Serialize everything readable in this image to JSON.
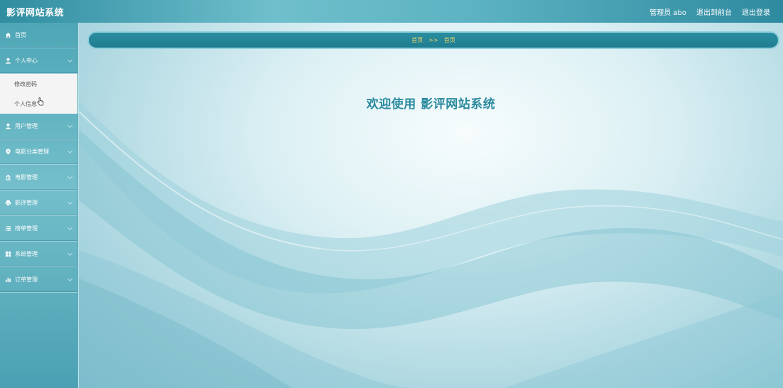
{
  "header": {
    "brand": "影评网站系统",
    "user_label": "管理员 abo",
    "frontend_link": "退出到前台",
    "logout_link": "退出登录"
  },
  "sidebar": {
    "items": [
      {
        "label": "首页",
        "icon": "home-icon"
      },
      {
        "label": "个人中心",
        "icon": "user-icon"
      },
      {
        "label": "用户管理",
        "icon": "user-icon"
      },
      {
        "label": "电影分类管理",
        "icon": "pin-icon"
      },
      {
        "label": "电影管理",
        "icon": "bank-icon"
      },
      {
        "label": "影评管理",
        "icon": "printer-icon"
      },
      {
        "label": "榜单管理",
        "icon": "list-icon"
      },
      {
        "label": "系统管理",
        "icon": "grid-icon"
      },
      {
        "label": "订单管理",
        "icon": "chart-icon"
      }
    ],
    "submenu": [
      {
        "label": "修改密码"
      },
      {
        "label": "个人信息"
      }
    ]
  },
  "breadcrumb": {
    "root": "首页",
    "separator": ">>",
    "current": "首页"
  },
  "main": {
    "welcome": "欢迎使用 影评网站系统"
  },
  "colors": {
    "accent": "#2a8ea0",
    "breadcrumb_text": "#f2d36a",
    "welcome_text": "#2a8a9e"
  }
}
